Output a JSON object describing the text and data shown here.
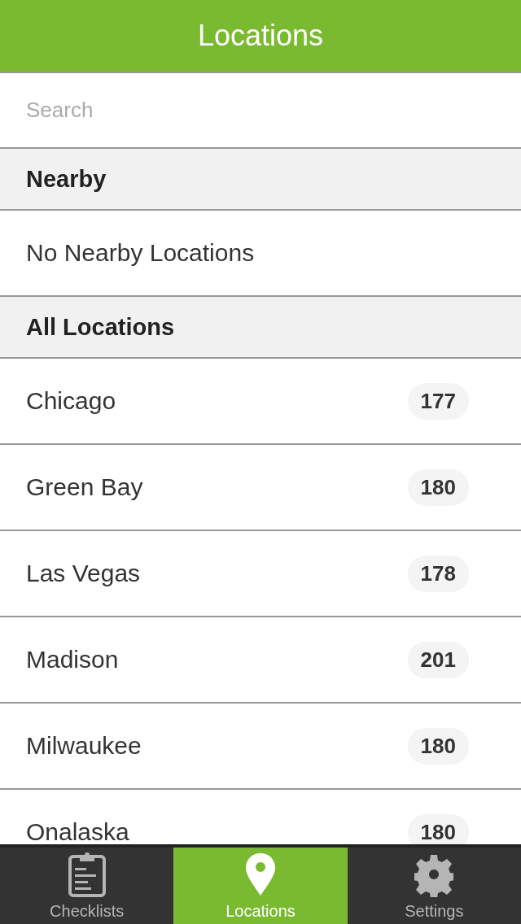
{
  "header": {
    "title": "Locations"
  },
  "search": {
    "placeholder": "Search"
  },
  "sections": [
    {
      "title": "Nearby",
      "rows": [
        {
          "kind": "empty",
          "label": "No Nearby Locations"
        }
      ]
    },
    {
      "title": "All Locations",
      "rows": [
        {
          "kind": "location",
          "label": "Chicago",
          "count": "177"
        },
        {
          "kind": "location",
          "label": "Green Bay",
          "count": "180"
        },
        {
          "kind": "location",
          "label": "Las Vegas",
          "count": "178"
        },
        {
          "kind": "location",
          "label": "Madison",
          "count": "201"
        },
        {
          "kind": "location",
          "label": "Milwaukee",
          "count": "180"
        },
        {
          "kind": "location",
          "label": "Onalaska",
          "count": "180"
        }
      ]
    }
  ],
  "tabs": [
    {
      "label": "Checklists",
      "kind": "clipboard",
      "selected": false
    },
    {
      "label": "Locations",
      "kind": "pin",
      "selected": true
    },
    {
      "label": "Settings",
      "kind": "gear",
      "selected": false
    }
  ]
}
